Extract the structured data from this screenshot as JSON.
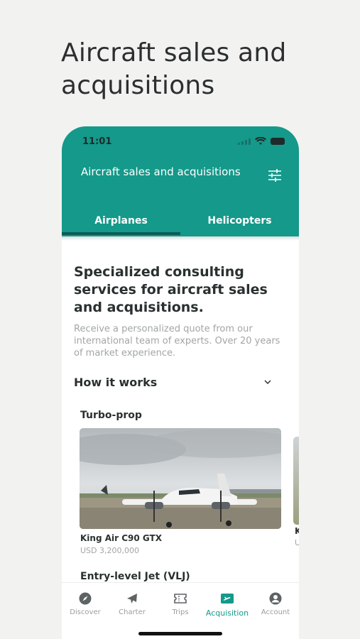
{
  "headline": "Aircraft sales and acquisitions",
  "status_bar": {
    "time": "11:01"
  },
  "app_bar": {
    "title": "Aircraft sales and acquisitions",
    "filter_icon": "sliders-icon",
    "color": "#14998a"
  },
  "tabs": [
    {
      "label": "Airplanes",
      "active": true
    },
    {
      "label": "Helicopters",
      "active": false
    }
  ],
  "hero": {
    "title": "Specialized consulting services for aircraft sales and acquisitions.",
    "description": "Receive a personalized quote from our international team of experts. Over 20 years of market experience."
  },
  "how_it_works": {
    "label": "How it works",
    "icon": "chevron-down-icon"
  },
  "sections": [
    {
      "title": "Turbo-prop",
      "cards": [
        {
          "name": "King Air C90 GTX",
          "price": "USD 3,200,000"
        },
        {
          "name": "K",
          "price": "U"
        }
      ]
    },
    {
      "title": "Entry-level Jet (VLJ)"
    }
  ],
  "bottom_nav": [
    {
      "label": "Discover",
      "icon": "compass-icon",
      "active": false
    },
    {
      "label": "Charter",
      "icon": "airplane-icon",
      "active": false
    },
    {
      "label": "Trips",
      "icon": "ticket-icon",
      "active": false
    },
    {
      "label": "Acquisition",
      "icon": "acquisition-plane-icon",
      "active": true
    },
    {
      "label": "Account",
      "icon": "user-icon",
      "active": false
    }
  ],
  "accent_color": "#14998a"
}
